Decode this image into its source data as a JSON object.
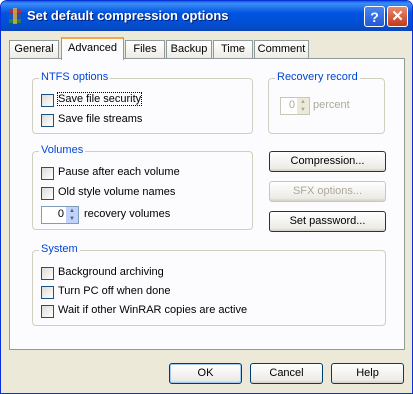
{
  "window": {
    "title": "Set default compression options",
    "help_glyph": "?",
    "close_glyph": "✕",
    "icon": "winrar-icon"
  },
  "tabs": [
    "General",
    "Advanced",
    "Files",
    "Backup",
    "Time",
    "Comment"
  ],
  "active_tab": "Advanced",
  "ntfs": {
    "title": "NTFS options",
    "save_security": "Save file security",
    "save_streams": "Save file streams"
  },
  "recovery_record": {
    "title": "Recovery record",
    "value": "0",
    "unit": "percent"
  },
  "volumes": {
    "title": "Volumes",
    "pause": "Pause after each volume",
    "old_style": "Old style volume names",
    "recovery_value": "0",
    "recovery_label": "recovery volumes"
  },
  "buttons": {
    "compression": "Compression...",
    "sfx": "SFX options...",
    "password": "Set password...",
    "ok": "OK",
    "cancel": "Cancel",
    "help": "Help"
  },
  "system": {
    "title": "System",
    "background": "Background archiving",
    "turn_off": "Turn PC off when done",
    "wait": "Wait if other WinRAR copies are active"
  }
}
